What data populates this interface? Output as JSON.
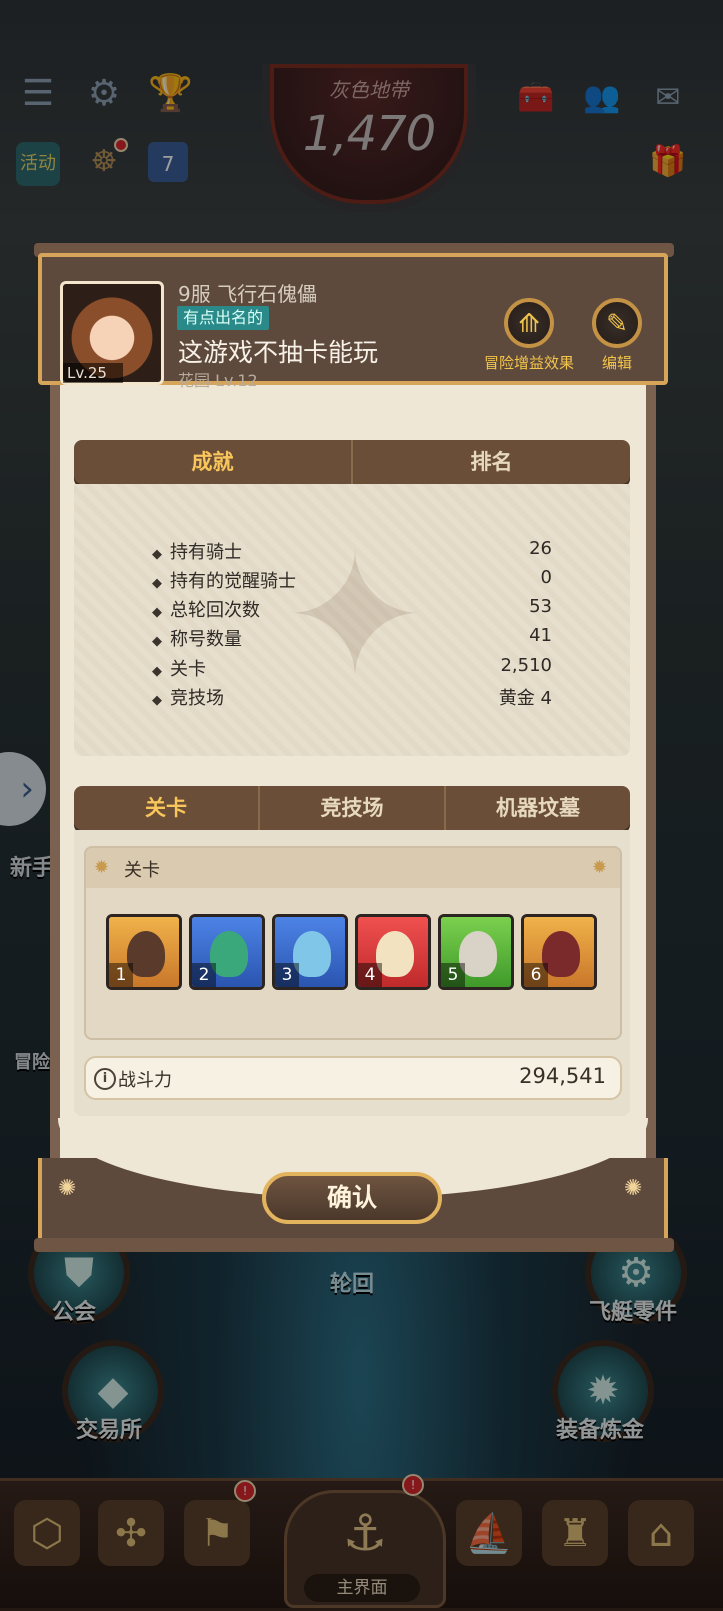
{
  "hud": {
    "zone_label": "灰色地带",
    "zone_value": "1,470",
    "event_label": "活动",
    "calendar_day": "7"
  },
  "background_labels": {
    "guild": "公会",
    "airship_parts": "飞艇零件",
    "trade": "交易所",
    "equipment_alchemy": "装备炼金",
    "reincarnation": "轮回",
    "novice": "新手",
    "adventure": "冒险"
  },
  "bottom_nav": {
    "home_label": "主界面"
  },
  "profile": {
    "server_name": "9服 飞行石傀儡",
    "title_badge": "有点出名的",
    "player_name": "这游戏不抽卡能玩",
    "garden": "花园 Lv.12",
    "level": "Lv.25",
    "buff_label": "冒险增益效果",
    "edit_label": "编辑"
  },
  "tabs_top": [
    "成就",
    "排名"
  ],
  "stats": [
    {
      "label": "持有骑士",
      "value": "26"
    },
    {
      "label": "持有的觉醒骑士",
      "value": "0"
    },
    {
      "label": "总轮回次数",
      "value": "53"
    },
    {
      "label": "称号数量",
      "value": "41"
    },
    {
      "label": "关卡",
      "value": "2,510"
    },
    {
      "label": "竞技场",
      "value": "黄金 4"
    }
  ],
  "tabs_mid": [
    "关卡",
    "竞技场",
    "机器坟墓"
  ],
  "stage": {
    "title": "关卡",
    "heroes": [
      {
        "num": "1",
        "color": "#e8a23a"
      },
      {
        "num": "2",
        "color": "#3b6fd6"
      },
      {
        "num": "3",
        "color": "#3b6fd6"
      },
      {
        "num": "4",
        "color": "#e23a3a"
      },
      {
        "num": "5",
        "color": "#5fb63a"
      },
      {
        "num": "6",
        "color": "#e8a23a"
      }
    ],
    "power_label": "战斗力",
    "power_value": "294,541"
  },
  "confirm_label": "确认"
}
